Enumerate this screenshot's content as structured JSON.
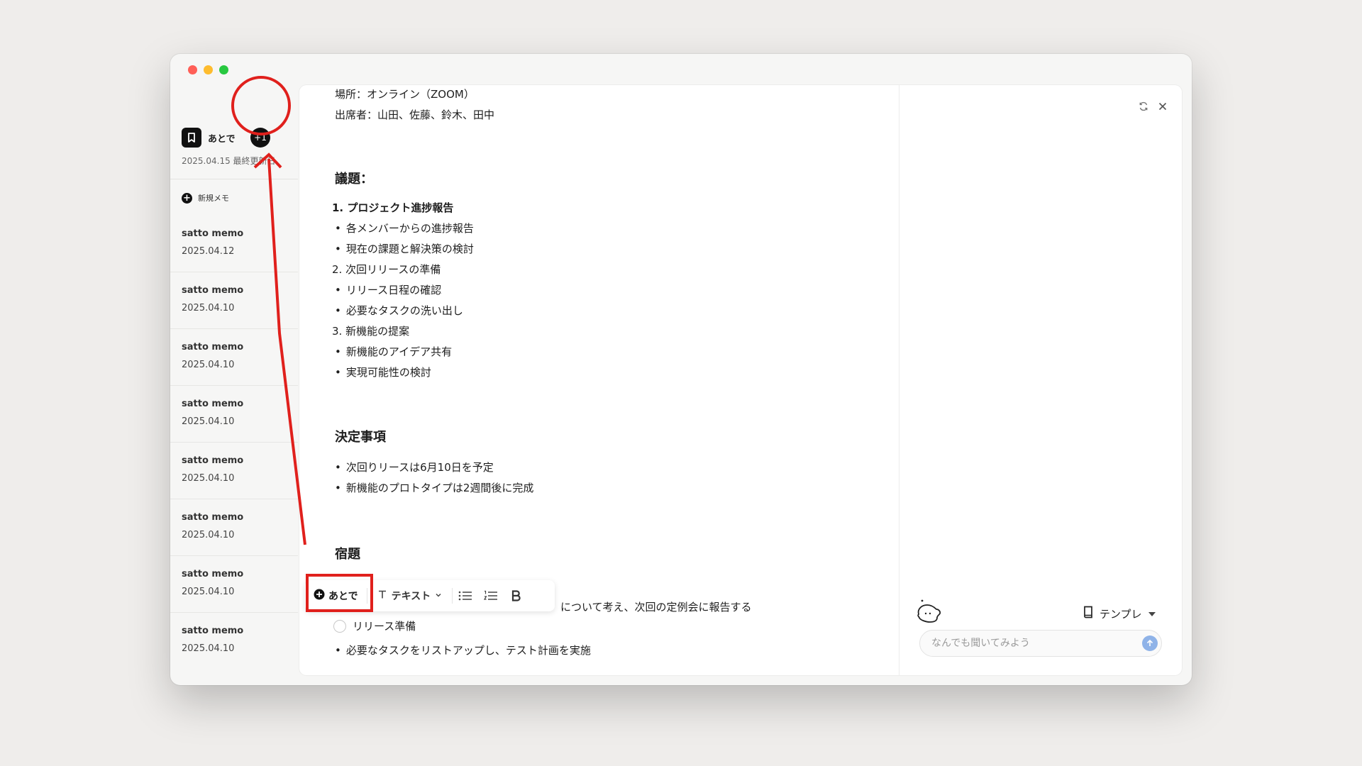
{
  "sidebar": {
    "atode_title": "あとで",
    "badge": "+1",
    "atode_date": "2025.04.15 最終更新日",
    "new_memo": "新規メモ",
    "memos": [
      {
        "title": "satto memo",
        "date": "2025.04.12"
      },
      {
        "title": "satto memo",
        "date": "2025.04.10"
      },
      {
        "title": "satto memo",
        "date": "2025.04.10"
      },
      {
        "title": "satto memo",
        "date": "2025.04.10"
      },
      {
        "title": "satto memo",
        "date": "2025.04.10"
      },
      {
        "title": "satto memo",
        "date": "2025.04.10"
      },
      {
        "title": "satto memo",
        "date": "2025.04.10"
      },
      {
        "title": "satto memo",
        "date": "2025.04.10"
      }
    ]
  },
  "doc": {
    "place": "場所：オンライン（ZOOM）",
    "attendees": "出席者：山田、佐藤、鈴木、田中",
    "agenda_heading": "議題：",
    "item1": "1. プロジェクト進捗報告",
    "item1_a": "各メンバーからの進捗報告",
    "item1_b": "現在の課題と解決策の検討",
    "item2": "2. 次回リリースの準備",
    "item2_a": "リリース日程の確認",
    "item2_b": "必要なタスクの洗い出し",
    "item3": "3. 新機能の提案",
    "item3_a": "新機能のアイデア共有",
    "item3_b": "実現可能性の検討",
    "decisions_heading": "決定事項",
    "decision1": "次回りリースは6月10日を予定",
    "decision2": "新機能のプロトタイプは2週間後に完成",
    "homework_heading": "宿題",
    "homework_partial": "について考え、次回の定例会に報告する",
    "todo_release": "リリース準備",
    "todo_tasks": "必要なタスクをリストアップし、テスト計画を実施"
  },
  "toolbar": {
    "atode_label": "あとで",
    "text_label": "テキスト"
  },
  "panel": {
    "template_label": "テンプレ",
    "chat_placeholder": "なんでも聞いてみよう"
  },
  "colors": {
    "annotation_red": "#e0201c",
    "send_button": "#8fb3e8"
  },
  "icons": [
    "bookmark-icon",
    "plus-circle-icon",
    "gear-icon",
    "text-format-icon",
    "chevron-down-icon",
    "bullet-list-icon",
    "numbered-list-icon",
    "bold-icon",
    "refresh-icon",
    "close-icon",
    "mascot-icon",
    "book-icon",
    "caret-down-icon",
    "arrow-up-icon"
  ]
}
